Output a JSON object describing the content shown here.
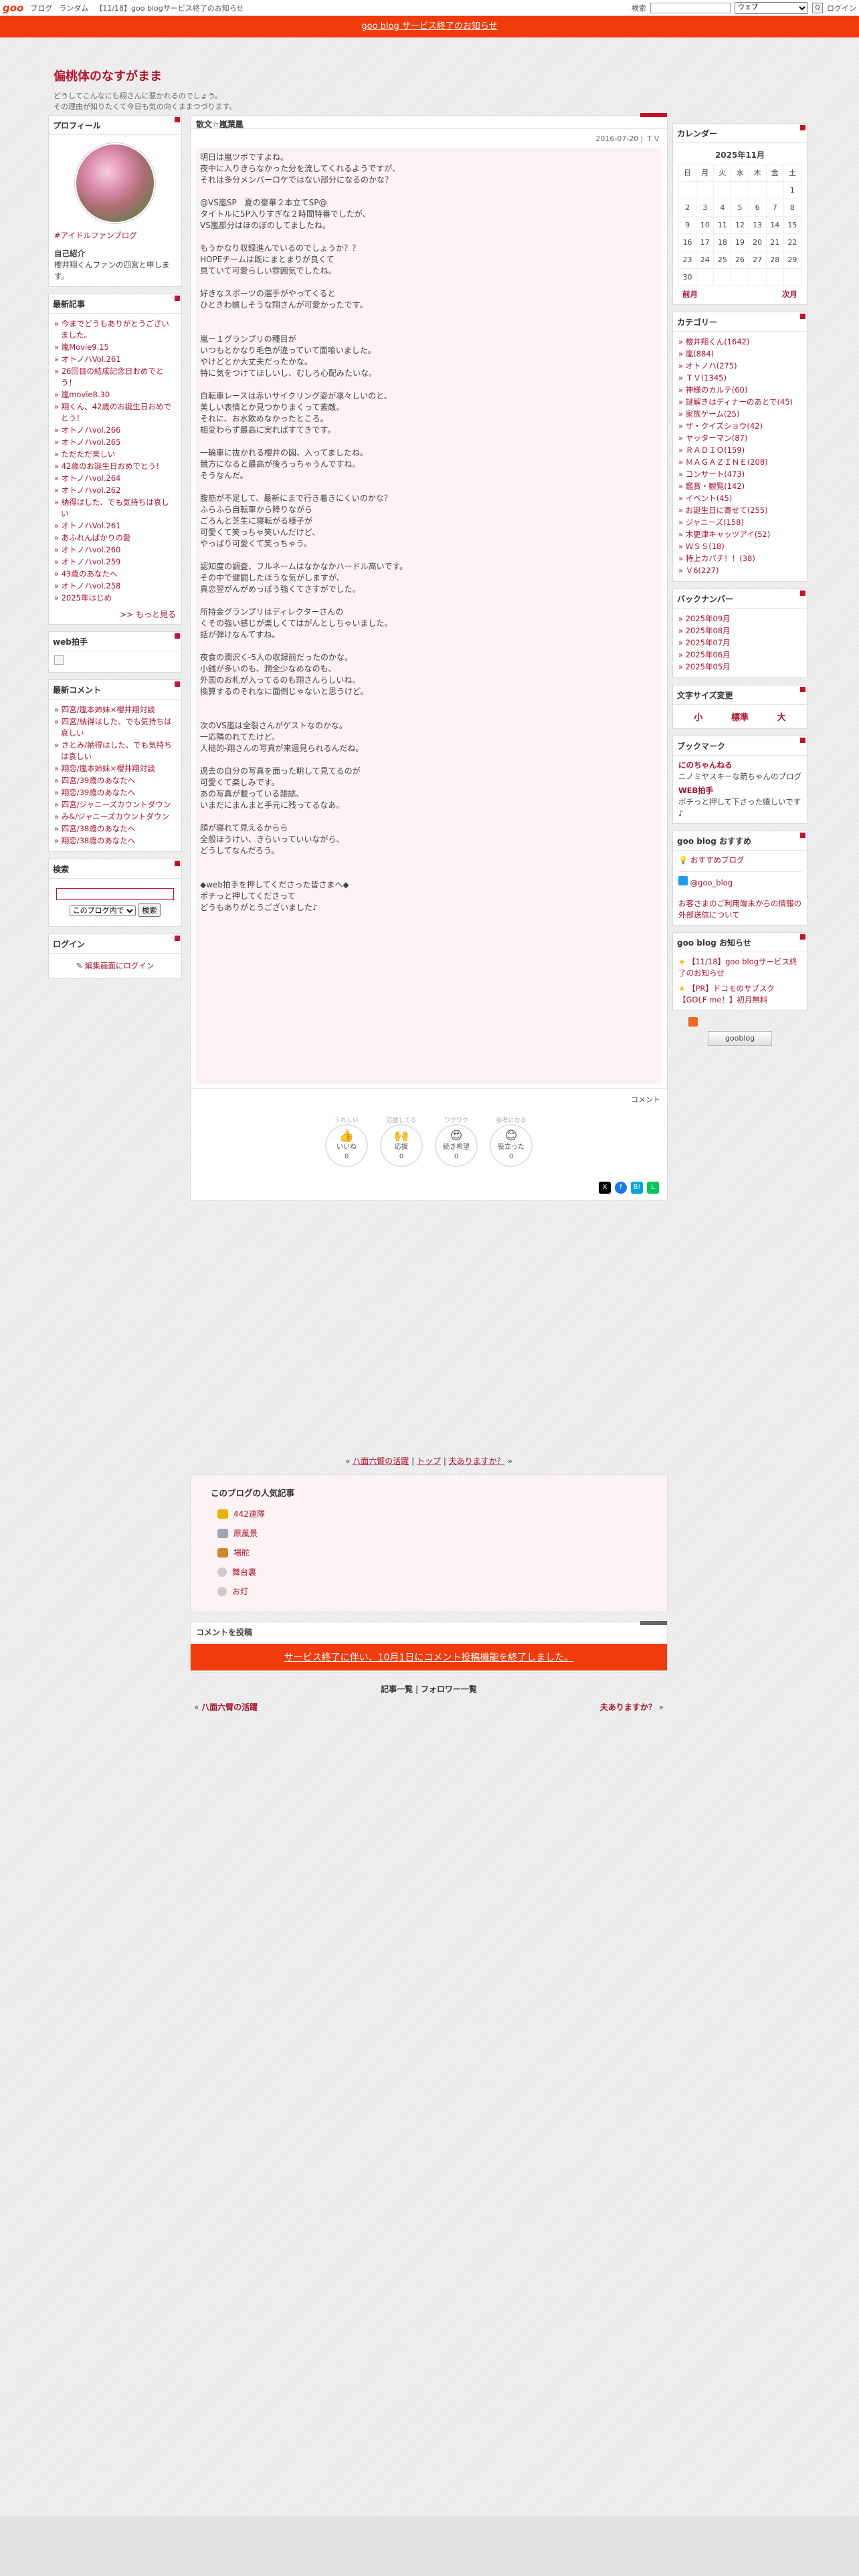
{
  "gbar": {
    "logo": "goo",
    "links": [
      "ブログ",
      "ランダム",
      "【11/18】goo blogサービス終了のお知らせ"
    ],
    "search_label": "検索",
    "scope": "ウェブ",
    "login": "ログイン"
  },
  "notice": "goo blog サービス終了のお知らせ",
  "blog": {
    "title": "偏桃体のなすがまま",
    "desc1": "どうしてこんなにも翔さんに惹かれるのでしょう。",
    "desc2": "その理由が知りたくて今日も気の向くままつづります。"
  },
  "profile": {
    "h": "プロフィール",
    "tag": "#アイドルファンブログ",
    "intro_h": "自己紹介",
    "intro": "櫻井翔くんファンの四宮と申します。"
  },
  "recent": {
    "h": "最新記事",
    "items": [
      "今までどうもありがとうございました。",
      "嵐Movie9.15",
      "オトノハVol.261",
      "26回目の結成記念日おめでとう！",
      "嵐movie8.30",
      "翔くん、42歳のお誕生日おめでとう！",
      "オトノハvol.266",
      "オトノハvol.265",
      "ただただ楽しい",
      "42歳のお誕生日おめでとう！",
      "オトノハvol.264",
      "オトノハvol.262",
      "納得はした、でも気持ちは哀しい",
      "オトノハVol.261",
      "あふれんばかりの愛",
      "オトノハvol.260",
      "オトノハvol.259",
      "43歳のあなたへ",
      "オトノハvol.258",
      "2025年はじめ"
    ],
    "more": ">> もっと見る"
  },
  "web_h": "web拍手",
  "comments": {
    "h": "最新コメント",
    "items": [
      "四宮/嵐本姉妹×櫻井翔対談",
      "四宮/納得はした、でも気持ちは哀しい",
      "さとみ/納得はした、でも気持ちは哀しい",
      "翔恋/嵐本姉妹×櫻井翔対談",
      "四宮/39歳のあなたへ",
      "翔恋/39歳のあなたへ",
      "四宮/ジャニーズカウントダウン",
      "み&/ジャニーズカウントダウン",
      "四宮/38歳のあなたへ",
      "翔恋/38歳のあなたへ"
    ]
  },
  "search": {
    "h": "検索",
    "scope": "このブログ内で",
    "btn": "検索"
  },
  "login": {
    "h": "ログイン",
    "link": "編集画面にログイン"
  },
  "post": {
    "cat": "散文☆嵐葉鳳",
    "date": "2016-07-20 | ＴＶ",
    "lines": [
      "明日は嵐ツボですよね。",
      "夜中に入りきらなかった分を流してくれるようですが、",
      "それは多分メンバーロケではない部分になるのかな？",
      "",
      "@VS嵐SP　夏の豪華２本立てSP@",
      "タイトルに5P入りすぎな２時間特番でしたが、",
      "VS嵐部分はほのぼのしてましたね。",
      "",
      "もうかなり収録進んでいるのでしょうか？？",
      "HOPEチームは既にまとまりが良くて",
      "見ていて可愛らしい雰囲気でしたね。",
      "",
      "好きなスポーツの選手がやってくると",
      "ひときわ嬉しそうな翔さんが可愛かったです。",
      "",
      "",
      "嵐－１グランプリの種目が",
      "いつもとかなり毛色が違っていて面喰いました。",
      "やけどとか大丈夫だったかな。",
      "特に気をつけてほしいし、むしろ心配みたいな。",
      "",
      "自転車レースは赤いサイクリング姿が凛々しいのと、",
      "美しい表情とか見つかりまくって素敵。",
      "それに、お水飲めなかったところ。",
      "相変わらず最高に実ればすてきです。",
      "",
      "一輪車に抜かれる櫻井の図、入ってましたね。",
      "競方になると最高が後ろっちゃうんですね。",
      "そうなんだ。",
      "",
      "腹筋が不足して、最新にまで行き着きにくいのかな？",
      "ふらふら自転車から降りながら",
      "ごろんと芝生に寝転がる様子が",
      "可愛くて笑っちゃ笑いんだけど、",
      "やっぱり可愛くて笑っちゃう。",
      "",
      "認知度の調査、フルネームはなかなかハードル高いです。",
      "その中で健闘したほうな気がしますが、",
      "真恋翌がんがめっぽう強くてさすがでした。",
      "",
      "所持金グランプリはディレクターさんの",
      "くその強い感じが楽しくてはがんとしちゃいました。",
      "話が弾けなんてすね。",
      "",
      "夜食の潤沢く-5人の収録前だったのかな。",
      "小銭が多いのも、潤全少なめなのも、",
      "外国のお札が入ってるのも翔さんらしいね。",
      "換算するのそれなに面倒じゃないと思うけど。",
      "",
      "",
      "次のVS嵐は全裂さんがゲストなのかな。",
      "一応隣のれてたけど。",
      "人槌的-翔さんの写真が来週見られるんだね。",
      "",
      "過去の自分の写真を面った眺して見てるのが",
      "可愛くて楽しみです。",
      "あの写真が載っている雑誌、",
      "いまだにまんまと手元に残ってるなあ。",
      "",
      "顔が寝れて見えるからら",
      "全般ほうけい、きらいっていいながら、",
      "どうしてなんだろう。",
      "",
      "",
      "◆web拍手を押してくださった皆さまへ◆",
      "ポチっと押してくださって",
      "どうもありがとうございました♪"
    ],
    "comment": "コメント"
  },
  "reactions": [
    {
      "lbl": "うれしい",
      "txt": "いいね",
      "n": "0",
      "e": "👍"
    },
    {
      "lbl": "応援してる",
      "txt": "応援",
      "n": "0",
      "e": "🙌"
    },
    {
      "lbl": "ワクワク",
      "txt": "続き希望",
      "n": "0",
      "e": "😍"
    },
    {
      "lbl": "参考になる",
      "txt": "役立った",
      "n": "0",
      "e": "😊"
    }
  ],
  "pager": {
    "prev": "八面六臂の活躍",
    "top": "トップ",
    "next": "夫ありますか？"
  },
  "popular": {
    "h": "このブログの人気記事",
    "items": [
      "442連隊",
      "原風景",
      "場舵",
      "舞台裏",
      "お灯"
    ]
  },
  "cpost": {
    "h": "コメントを投稿",
    "warn": "サービス終了に伴い、10月1日にコメント投稿機能を終了しました。",
    "list": "記事一覧",
    "follow": "フォロワー一覧",
    "prev": "八面六臂の活躍",
    "next": "夫ありますか？"
  },
  "calendar": {
    "h": "カレンダー",
    "title": "2025年11月",
    "days": [
      "日",
      "月",
      "火",
      "水",
      "木",
      "金",
      "土"
    ],
    "weeks": [
      [
        "",
        "",
        "",
        "",
        "",
        "",
        "1"
      ],
      [
        "2",
        "3",
        "4",
        "5",
        "6",
        "7",
        "8"
      ],
      [
        "9",
        "10",
        "11",
        "12",
        "13",
        "14",
        "15"
      ],
      [
        "16",
        "17",
        "18",
        "19",
        "20",
        "21",
        "22"
      ],
      [
        "23",
        "24",
        "25",
        "26",
        "27",
        "28",
        "29"
      ],
      [
        "30",
        "",
        "",
        "",
        "",
        "",
        ""
      ]
    ],
    "prev": "前月",
    "next": "次月"
  },
  "categories": {
    "h": "カテゴリー",
    "items": [
      "櫻井翔くん(1642)",
      "嵐(884)",
      "オトノハ(275)",
      "ＴＶ(1345)",
      "神様のカルテ(60)",
      "謎解きはディナーのあとで(45)",
      "家族ゲーム(25)",
      "ザ・クイズショウ(42)",
      "ヤッターマン(87)",
      "ＲＡＤＩＯ(159)",
      "ＭＡＧＡＺＩＮＥ(208)",
      "コンサート(473)",
      "鑑賞・観覧(142)",
      "イベント(45)",
      "お誕生日に寄せて(255)",
      "ジャニーズ(158)",
      "木更津キャッツアイ(52)",
      "ＷＳＳ(18)",
      "特上カバチ！！(38)",
      "Ｖ6(227)"
    ]
  },
  "backnumber": {
    "h": "バックナンバー",
    "items": [
      "2025年09月",
      "2025年08月",
      "2025年07月",
      "2025年06月",
      "2025年05月"
    ]
  },
  "fontsize": {
    "h": "文字サイズ変更",
    "s": "小",
    "m": "標準",
    "l": "大"
  },
  "bookmark": {
    "h": "ブックマーク",
    "t1": "にのちゃんねる",
    "d1": "ニノミヤスキーな箭ちゃんのブログ",
    "t2": "WEB拍手",
    "d2": "ポチっと押して下さった嬉しいです♪"
  },
  "recommend": {
    "h": "goo blog おすすめ",
    "a": "おすすめブログ",
    "b": "@goo_blog",
    "c": "お客さまのご利用端末からの情報の外部送信について"
  },
  "news": {
    "h": "goo blog お知らせ",
    "a": "【11/18】goo blogサービス終了のお知らせ",
    "b": "【PR】ドコモのサブスク【GOLF me！】初月無料"
  },
  "rss": "gooblog"
}
